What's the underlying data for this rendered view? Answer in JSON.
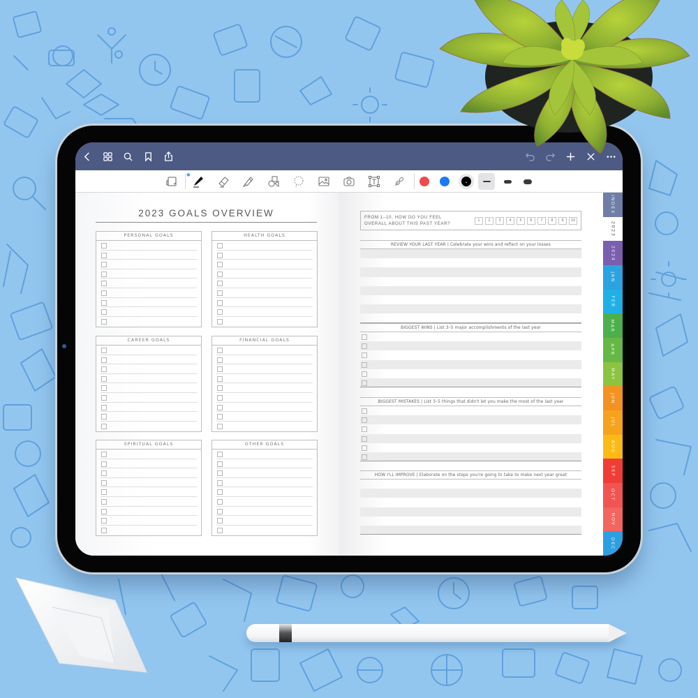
{
  "scene": {
    "background_color": "#93c6ef",
    "objects": [
      "succulent-plant",
      "paper-boat",
      "stylus-pencil"
    ]
  },
  "navbar": {
    "bg_color": "#4c5a84",
    "left_icons": [
      "back-icon",
      "grid-icon",
      "search-icon",
      "bookmark-icon",
      "share-icon"
    ],
    "right_icons": [
      "undo-icon",
      "redo-icon",
      "plus-icon",
      "close-icon",
      "more-icon"
    ]
  },
  "toolbar": {
    "tools": [
      "page-layout-icon",
      "pen-icon",
      "eraser-icon",
      "highlighter-icon",
      "shapes-icon",
      "lasso-icon",
      "image-icon",
      "camera-icon",
      "text-icon",
      "link-icon"
    ],
    "bluetooth_mark": "✱",
    "colors": [
      {
        "name": "red",
        "hex": "#f04b4b"
      },
      {
        "name": "blue",
        "hex": "#1a7cf0"
      },
      {
        "name": "black",
        "hex": "#000000",
        "selected": true
      }
    ],
    "thickness_options": [
      "thin",
      "medium",
      "thick"
    ],
    "selected_thickness": "thin"
  },
  "left_page": {
    "title": "2023 GOALS OVERVIEW",
    "goal_boxes": [
      {
        "label": "PERSONAL GOALS",
        "checkbox_count": 9
      },
      {
        "label": "HEALTH GOALS",
        "checkbox_count": 9
      },
      {
        "label": "CAREER GOALS",
        "checkbox_count": 9
      },
      {
        "label": "FINANCIAL GOALS",
        "checkbox_count": 9
      },
      {
        "label": "SPIRITUAL GOALS",
        "checkbox_count": 9
      },
      {
        "label": "OTHER GOALS",
        "checkbox_count": 9
      }
    ]
  },
  "right_page": {
    "rating": {
      "question_line1": "FROM 1–10, HOW DO YOU FEEL",
      "question_line2": "OVERALL ABOUT THIS PAST YEAR?",
      "options": [
        "1",
        "2",
        "3",
        "4",
        "5",
        "6",
        "7",
        "8",
        "9",
        "10"
      ]
    },
    "sections": [
      {
        "heading": "REVIEW YOUR LAST YEAR | Celebrate your wins and reflect on your losses",
        "rows": 8,
        "checkboxes": false
      },
      {
        "heading": "BIGGEST WINS | List 3–5 major accomplishments of the last year",
        "rows": 6,
        "checkboxes": true
      },
      {
        "heading": "BIGGEST MISTAKES | List 3–5 things that didn't let you make the most of the last year",
        "rows": 6,
        "checkboxes": true
      },
      {
        "heading": "HOW I'LL IMPROVE | Elaborate on the steps you're going to take to make next year great",
        "rows": 6,
        "checkboxes": false
      }
    ]
  },
  "tabs": [
    {
      "label": "INDEX",
      "color": "#6f7ea6"
    },
    {
      "label": "2023",
      "color": "#ffffff",
      "current": true
    },
    {
      "label": "2024",
      "color": "#7b5fae"
    },
    {
      "label": "JAN",
      "color": "#2aa3e0"
    },
    {
      "label": "FEB",
      "color": "#1fb0e6"
    },
    {
      "label": "MAR",
      "color": "#4cb04c"
    },
    {
      "label": "APR",
      "color": "#66b845"
    },
    {
      "label": "MAY",
      "color": "#8cc43f"
    },
    {
      "label": "JUN",
      "color": "#f39221"
    },
    {
      "label": "JUL",
      "color": "#f7a21c"
    },
    {
      "label": "AUG",
      "color": "#fbbb14"
    },
    {
      "label": "SEP",
      "color": "#ee3e36"
    },
    {
      "label": "OCT",
      "color": "#f05552"
    },
    {
      "label": "NOV",
      "color": "#f2665f"
    },
    {
      "label": "DEC",
      "color": "#2d9fe0"
    }
  ]
}
